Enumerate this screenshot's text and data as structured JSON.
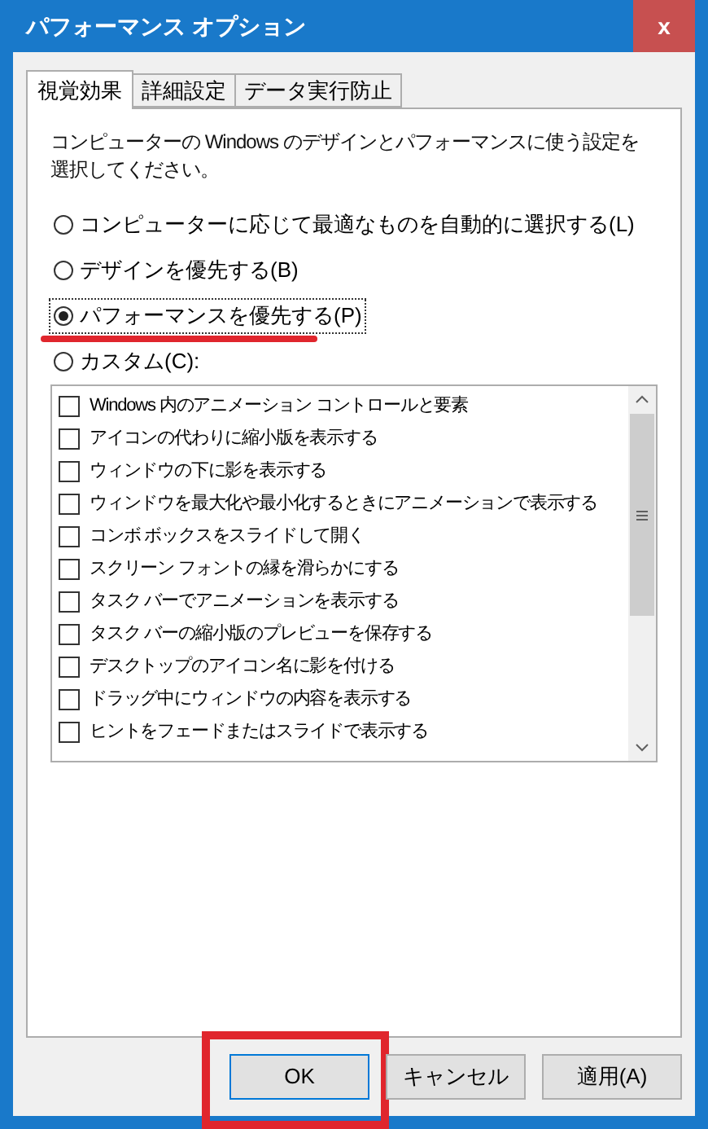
{
  "window": {
    "title": "パフォーマンス オプション",
    "close": "x"
  },
  "tabs": [
    {
      "label": "視覚効果",
      "selected": true
    },
    {
      "label": "詳細設定",
      "selected": false
    },
    {
      "label": "データ実行防止",
      "selected": false
    }
  ],
  "description": "コンピューターの Windows のデザインとパフォーマンスに使う設定を選択してください。",
  "options": [
    {
      "label": "コンピューターに応じて最適なものを自動的に選択する(L)",
      "selected": false,
      "annotated": false
    },
    {
      "label": "デザインを優先する(B)",
      "selected": false,
      "annotated": false
    },
    {
      "label": "パフォーマンスを優先する(P)",
      "selected": true,
      "annotated": true
    },
    {
      "label": "カスタム(C):",
      "selected": false,
      "annotated": false
    }
  ],
  "effects": [
    {
      "label": "Windows 内のアニメーション コントロールと要素",
      "checked": false
    },
    {
      "label": "アイコンの代わりに縮小版を表示する",
      "checked": false
    },
    {
      "label": "ウィンドウの下に影を表示する",
      "checked": false
    },
    {
      "label": "ウィンドウを最大化や最小化するときにアニメーションで表示する",
      "checked": false
    },
    {
      "label": "コンボ ボックスをスライドして開く",
      "checked": false
    },
    {
      "label": "スクリーン フォントの縁を滑らかにする",
      "checked": false
    },
    {
      "label": "タスク バーでアニメーションを表示する",
      "checked": false
    },
    {
      "label": "タスク バーの縮小版のプレビューを保存する",
      "checked": false
    },
    {
      "label": "デスクトップのアイコン名に影を付ける",
      "checked": false
    },
    {
      "label": "ドラッグ中にウィンドウの内容を表示する",
      "checked": false
    },
    {
      "label": "ヒントをフェードまたはスライドで表示する",
      "checked": false
    }
  ],
  "buttons": [
    {
      "label": "OK",
      "highlighted": true
    },
    {
      "label": "キャンセル",
      "highlighted": false
    },
    {
      "label": "適用(A)",
      "highlighted": false
    }
  ]
}
